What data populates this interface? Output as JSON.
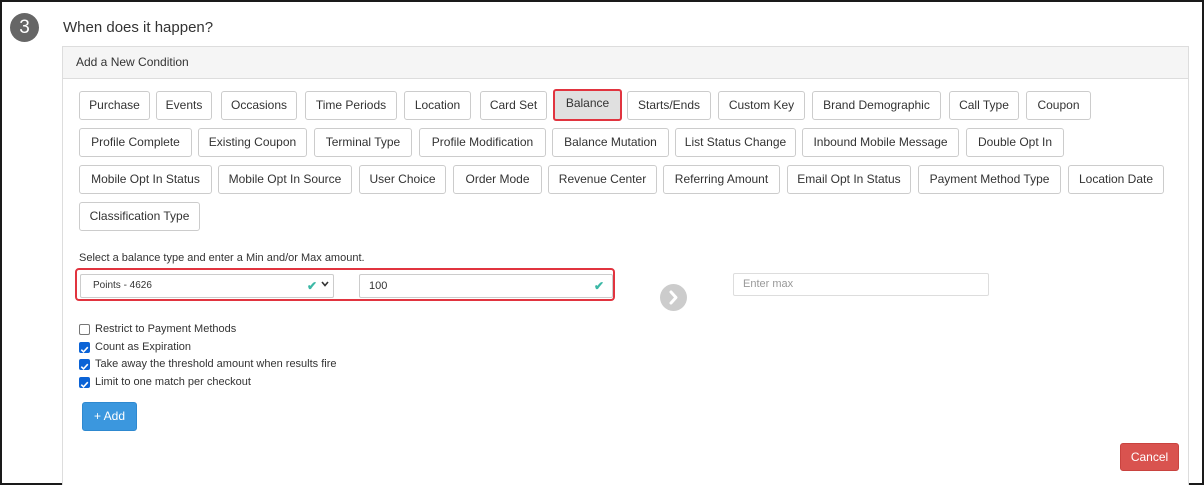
{
  "step": {
    "number": "3",
    "title": "When does it happen?"
  },
  "panel": {
    "header": "Add a New Condition"
  },
  "conditions": [
    "Purchase",
    "Events",
    "Occasions",
    "Time Periods",
    "Location",
    "Card Set",
    "Balance",
    "Starts/Ends",
    "Custom Key",
    "Brand Demographic",
    "Call Type",
    "Coupon",
    "Profile Complete",
    "Existing Coupon",
    "Terminal Type",
    "Profile Modification",
    "Balance Mutation",
    "List Status Change",
    "Inbound Mobile Message",
    "Double Opt In",
    "Mobile Opt In Status",
    "Mobile Opt In Source",
    "User Choice",
    "Order Mode",
    "Revenue Center",
    "Referring Amount",
    "Email Opt In Status",
    "Payment Method Type",
    "Location Date",
    "Classification Type"
  ],
  "selected_condition": "Balance",
  "balance": {
    "hint": "Select a balance type and enter a Min and/or Max amount.",
    "type_value": "Points - 4626",
    "min_value": "100",
    "max_placeholder": "Enter max"
  },
  "options": [
    {
      "label": "Restrict to Payment Methods",
      "checked": false
    },
    {
      "label": "Count as Expiration",
      "checked": true
    },
    {
      "label": "Take away the threshold amount when results fire",
      "checked": true
    },
    {
      "label": "Limit to one match per checkout",
      "checked": true
    }
  ],
  "buttons": {
    "add": "+ Add",
    "cancel": "Cancel"
  },
  "colors": {
    "highlight": "#e1343f",
    "primary": "#3b97de",
    "danger": "#d9534f",
    "checkbox": "#0b63d6",
    "valid_check": "#3cb8a6"
  }
}
